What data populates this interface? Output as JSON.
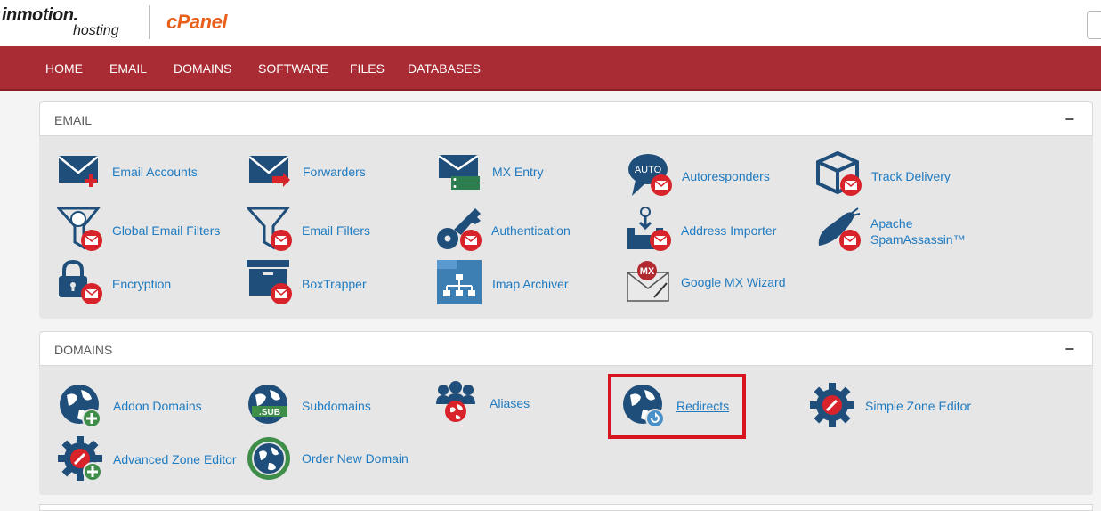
{
  "header": {
    "inmotion_brand": "inmotion.",
    "inmotion_sub": "hosting",
    "cpanel_logo": "cPanel"
  },
  "nav": {
    "items": [
      "HOME",
      "EMAIL",
      "DOMAINS",
      "SOFTWARE",
      "FILES",
      "DATABASES"
    ]
  },
  "email_panel": {
    "title": "EMAIL",
    "collapse": "−",
    "items": [
      {
        "label": "Email Accounts",
        "icon": "email-accounts-icon"
      },
      {
        "label": "Forwarders",
        "icon": "forwarders-icon"
      },
      {
        "label": "MX Entry",
        "icon": "mx-entry-icon"
      },
      {
        "label": "Autoresponders",
        "icon": "autoresponders-icon",
        "badge": "AUTO"
      },
      {
        "label": "Track Delivery",
        "icon": "track-delivery-icon"
      },
      {
        "label": "Global Email Filters",
        "icon": "global-email-filters-icon"
      },
      {
        "label": "Email Filters",
        "icon": "email-filters-icon"
      },
      {
        "label": "Authentication",
        "icon": "authentication-icon"
      },
      {
        "label": "Address Importer",
        "icon": "address-importer-icon"
      },
      {
        "label": "Apache SpamAssassin™",
        "icon": "spamassassin-icon"
      },
      {
        "label": "Encryption",
        "icon": "encryption-icon"
      },
      {
        "label": "BoxTrapper",
        "icon": "boxtrapper-icon"
      },
      {
        "label": "Imap Archiver",
        "icon": "imap-archiver-icon"
      },
      {
        "label": "Google MX Wizard",
        "icon": "google-mx-wizard-icon",
        "badge": "MX"
      }
    ]
  },
  "domains_panel": {
    "title": "DOMAINS",
    "collapse": "−",
    "items": [
      {
        "label": "Addon Domains",
        "icon": "addon-domains-icon"
      },
      {
        "label": "Subdomains",
        "icon": "subdomains-icon",
        "badge": ".SUB"
      },
      {
        "label": "Aliases",
        "icon": "aliases-icon"
      },
      {
        "label": "Redirects",
        "icon": "redirects-icon",
        "highlighted": true
      },
      {
        "label": "Simple Zone Editor",
        "icon": "simple-zone-editor-icon"
      },
      {
        "label": "Advanced Zone Editor",
        "icon": "advanced-zone-editor-icon"
      },
      {
        "label": "Order New Domain",
        "icon": "order-new-domain-icon"
      }
    ]
  },
  "colors": {
    "nav_bg": "#a92b33",
    "link": "#1f7bc1",
    "icon_navy": "#1e4e79",
    "badge_red": "#d8232a",
    "highlight": "#d8141e",
    "cpanel_orange": "#e8601c"
  }
}
